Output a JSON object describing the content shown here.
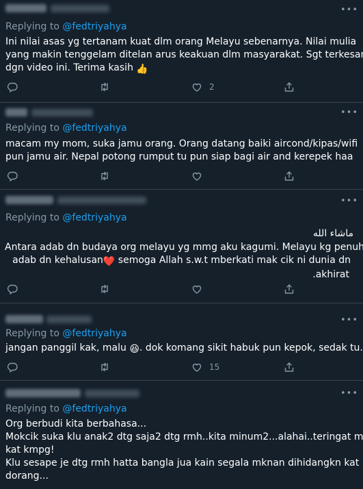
{
  "replying_prefix": "Replying to ",
  "replying_handle": "@fedtriyahya",
  "tweets": [
    {
      "lines": [
        "Ini nilai asas yg tertanam kuat dlm orang Melayu sebenarnya. Nilai mulia",
        "yang  makin tenggelam ditelan arus keakuan dlm masyarakat. Sgt terkesan",
        "dgn video ini. Terima kasih"
      ],
      "emoji_name": "thumbs-up",
      "emoji": "👍",
      "like_count": "2"
    },
    {
      "lines": [
        "macam my mom, suka jamu orang. Orang datang baiki aircond/kipas/wifi",
        "pun jamu air. Nepal potong rumput tu pun siap bagi air and kerepek haa"
      ],
      "like_count": ""
    },
    {
      "arabic": "ماشاء الله",
      "lines": [
        "Antara  adab dn budaya org melayu yg mmg aku kagumi. Melayu kg penuh",
        "semoga Allah s.w.t mberkati mak cik ni dunia dn",
        "akhirat."
      ],
      "line2_prefix": "adab dn kehalusan",
      "emoji_name": "red-heart",
      "emoji": "❤️",
      "like_count": ""
    },
    {
      "lines": [
        "jangan panggil kak, malu",
        ". dok komang sikit habuk pun kepok, sedak tu."
      ],
      "emoji_name": "grinning-squinting-face",
      "emoji": "😆",
      "like_count": "15"
    },
    {
      "lines": [
        "Org berbudi kita berbahasa...",
        "Mokcik suka klu anak2 dtg saja2 dtg rmh..kita minum2...alahai..teringat mak",
        "kat kmpg!",
        "Klu sesape je dtg rmh hatta bangla jua kain segala mknan dihidangkn kat",
        "dorang..."
      ],
      "like_count": ""
    }
  ],
  "icons": {
    "reply": "reply-icon",
    "retweet": "retweet-icon",
    "like": "heart-icon",
    "share": "share-icon",
    "more": "more-icon"
  },
  "colors": {
    "background": "#15202b",
    "text": "#ffffff",
    "muted": "#8899a6",
    "link": "#1da1f2",
    "divider": "#38444d"
  }
}
